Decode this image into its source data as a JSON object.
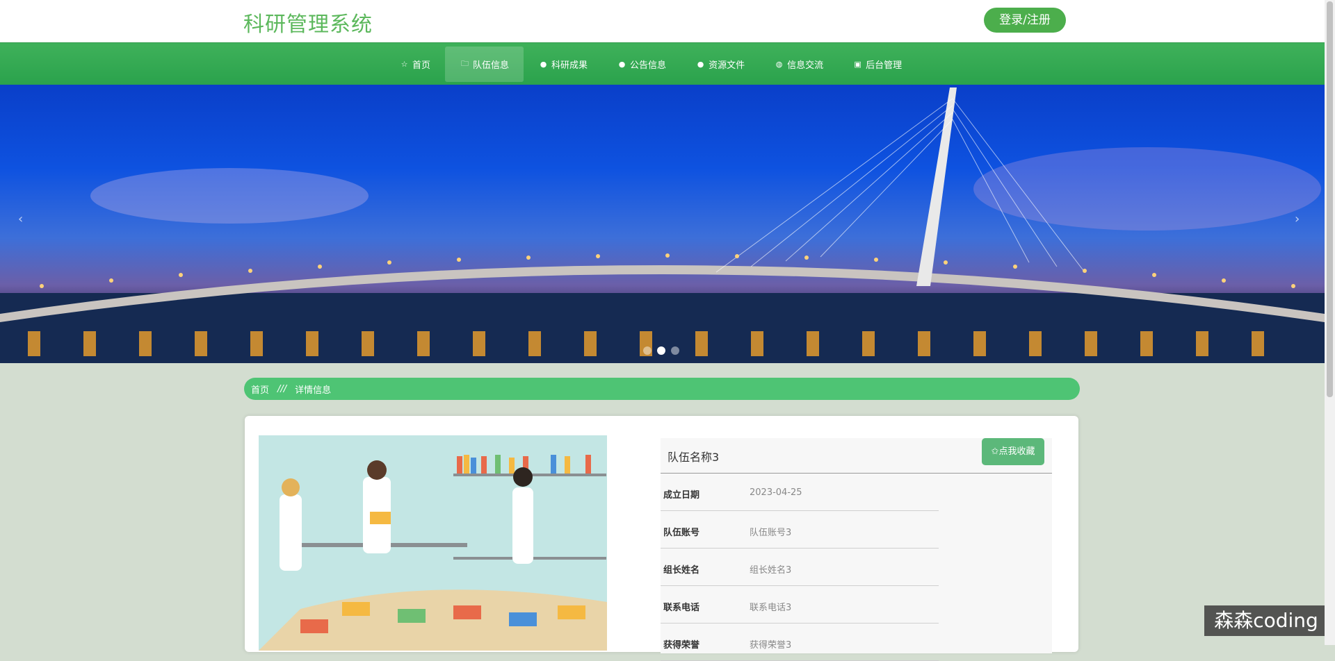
{
  "header": {
    "title": "科研管理系统",
    "login_label": "登录/注册"
  },
  "nav": {
    "items": [
      {
        "label": "首页",
        "icon": "star-icon",
        "glyph": "☆"
      },
      {
        "label": "队伍信息",
        "icon": "bag-icon",
        "glyph": "🗀"
      },
      {
        "label": "科研成果",
        "icon": "info-icon",
        "glyph": "●"
      },
      {
        "label": "公告信息",
        "icon": "info-icon",
        "glyph": "●"
      },
      {
        "label": "资源文件",
        "icon": "info-icon",
        "glyph": "●"
      },
      {
        "label": "信息交流",
        "icon": "globe-icon",
        "glyph": "◍"
      },
      {
        "label": "后台管理",
        "icon": "briefcase-icon",
        "glyph": "▣"
      }
    ],
    "active_index": 1
  },
  "banner": {
    "prev": "‹",
    "next": "›",
    "slide_count": 3,
    "active_slide": 1
  },
  "breadcrumb": {
    "home": "首页",
    "separator": "///",
    "current": "详情信息"
  },
  "detail": {
    "team_name": "队伍名称3",
    "favorite_label": "✩点我收藏",
    "fields": [
      {
        "label": "成立日期",
        "value": "2023-04-25"
      },
      {
        "label": "队伍账号",
        "value": "队伍账号3"
      },
      {
        "label": "组长姓名",
        "value": "组长姓名3"
      },
      {
        "label": "联系电话",
        "value": "联系电话3"
      },
      {
        "label": "获得荣誉",
        "value": "获得荣誉3"
      }
    ]
  },
  "watermark": "森森coding",
  "colors": {
    "brand_green": "#5cb85c",
    "nav_green": "#2aa24c",
    "crumb_green": "#4ec474"
  }
}
